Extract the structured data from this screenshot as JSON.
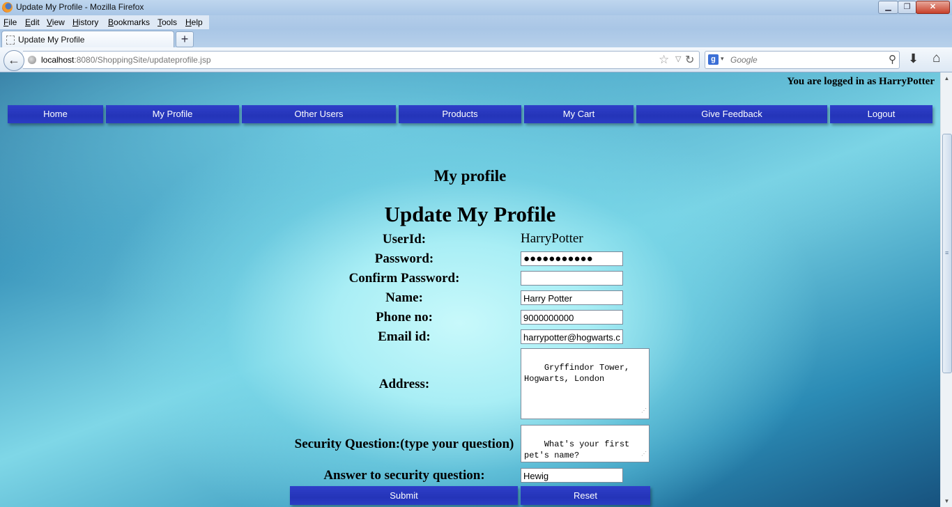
{
  "window": {
    "title": "Update My Profile - Mozilla Firefox",
    "min_glyph": "▁",
    "max_glyph": "❐",
    "close_glyph": "✕"
  },
  "menu": [
    {
      "label": "File",
      "underline": "F",
      "rest": "ile"
    },
    {
      "label": "Edit",
      "underline": "E",
      "rest": "dit"
    },
    {
      "label": "View",
      "underline": "V",
      "rest": "iew"
    },
    {
      "label": "History",
      "underline": "H",
      "rest": "istory"
    },
    {
      "label": "Bookmarks",
      "underline": "B",
      "rest": "ookmarks"
    },
    {
      "label": "Tools",
      "underline": "T",
      "rest": "ools"
    },
    {
      "label": "Help",
      "underline": "H",
      "rest": "elp"
    }
  ],
  "tab": {
    "title": "Update My Profile",
    "new_tab_glyph": "+"
  },
  "toolbar": {
    "back_glyph": "←",
    "url_host": "localhost",
    "url_path": ":8080/ShoppingSite/updateprofile.jsp",
    "star_glyph": "☆",
    "dropdown_glyph": "▽",
    "reload_glyph": "↻",
    "search_engine_glyph": "g",
    "search_placeholder": "Google",
    "search_glyph": "⚲",
    "download_glyph": "⬇",
    "home_glyph": "⌂"
  },
  "page": {
    "logged_in_text": "You are logged in as HarryPotter",
    "nav": [
      {
        "label": "Home"
      },
      {
        "label": "My Profile"
      },
      {
        "label": "Other Users"
      },
      {
        "label": "Products"
      },
      {
        "label": "My Cart"
      },
      {
        "label": "Give Feedback"
      },
      {
        "label": "Logout"
      }
    ],
    "section_heading": "My profile",
    "form_title": "Update My Profile",
    "form": {
      "userid_label": "UserId:",
      "userid_value": "HarryPotter",
      "password_label": "Password:",
      "password_value": "●●●●●●●●●●●",
      "confirm_label": "Confirm Password:",
      "confirm_value": "",
      "name_label": "Name:",
      "name_value": "Harry Potter",
      "phone_label": "Phone no:",
      "phone_value": "9000000000",
      "email_label": "Email id:",
      "email_value": "harrypotter@hogwarts.c",
      "address_label": "Address:",
      "address_value": "Gryffindor Tower,\nHogwarts, London",
      "question_label": "Security Question:(type your question)",
      "question_value": "What's your first\npet's name?",
      "answer_label": "Answer to security question:",
      "answer_value": "Hewig",
      "submit_label": "Submit",
      "reset_label": "Reset",
      "resize_grip_glyph": "⋰"
    }
  },
  "scrollbar": {
    "up_glyph": "▲",
    "down_glyph": "▼",
    "grip_glyph": "≡"
  }
}
